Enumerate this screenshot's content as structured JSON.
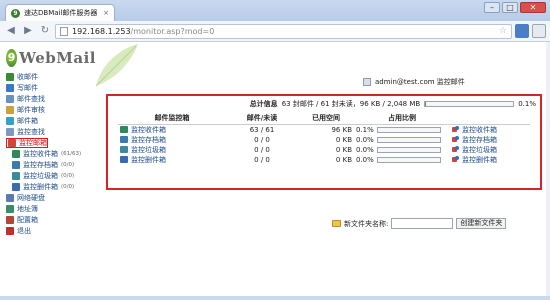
{
  "browser": {
    "tab_title": "速达DBMail邮件服务器 - V",
    "tab_close": "×",
    "url_host": "192.168.1.253",
    "url_path": "/monitor.asp?mod=0",
    "back": "◀",
    "forward": "▶",
    "reload": "↻",
    "star": "☆",
    "minimize": "–",
    "maximize": "□",
    "close": "✕"
  },
  "app": {
    "logo_letter": "9",
    "logo_text": "WebMail",
    "user_line": "admin@test.com 监控邮件"
  },
  "sidebar": {
    "items": [
      {
        "label": "收邮件",
        "icon": "inbox-icon",
        "color": "#3a8c3a"
      },
      {
        "label": "写邮件",
        "icon": "compose-icon",
        "color": "#3a78c9"
      },
      {
        "label": "邮件查找",
        "icon": "search-icon",
        "color": "#6b8fbf"
      },
      {
        "label": "邮件审核",
        "icon": "audit-icon",
        "color": "#c9a33a"
      },
      {
        "label": "邮件箱",
        "icon": "mailbox-icon",
        "color": "#3aa0c9"
      },
      {
        "label": "监控查找",
        "icon": "monitor-search-icon",
        "color": "#7a9ac0"
      },
      {
        "label": "监控邮箱",
        "icon": "monitor-icon",
        "color": "#c94a3a"
      },
      {
        "label": "网络硬盘",
        "icon": "disk-icon",
        "color": "#5a7ab0"
      },
      {
        "label": "地址簿",
        "icon": "addressbook-icon",
        "color": "#3a8c6a"
      },
      {
        "label": "配置箱",
        "icon": "config-icon",
        "color": "#b0473a"
      },
      {
        "label": "退出",
        "icon": "exit-icon",
        "color": "#c92a2a"
      }
    ],
    "sub_items": [
      {
        "label": "监控收件箱",
        "count": "(61/63)",
        "color": "#2f8a5a"
      },
      {
        "label": "监控存档箱",
        "count": "(0/0)",
        "color": "#3a7ab0"
      },
      {
        "label": "监控垃圾箱",
        "count": "(0/0)",
        "color": "#3a8c9a"
      },
      {
        "label": "监控删件箱",
        "count": "(0/0)",
        "color": "#3a6ab0"
      }
    ]
  },
  "summary": {
    "label": "总计信息",
    "text": "63 封邮件 / 61 封未读，96 KB / 2,048 MB",
    "percent_text": "0.1%",
    "percent_value": 0.001
  },
  "table": {
    "headers": [
      "邮件监控箱",
      "邮件/未读",
      "已用空间",
      "占用比例",
      ""
    ],
    "rows": [
      {
        "name": "监控收件箱",
        "counts": "63 / 61",
        "space": "96 KB",
        "pct": "0.1%",
        "pct_value": 0.001,
        "action": "监控收件箱",
        "color": "#2f8a5a"
      },
      {
        "name": "监控存档箱",
        "counts": "0 / 0",
        "space": "0 KB",
        "pct": "0.0%",
        "pct_value": 0.0,
        "action": "监控存档箱",
        "color": "#3a7ab0"
      },
      {
        "name": "监控垃圾箱",
        "counts": "0 / 0",
        "space": "0 KB",
        "pct": "0.0%",
        "pct_value": 0.0,
        "action": "监控垃圾箱",
        "color": "#3a8c9a"
      },
      {
        "name": "监控删件箱",
        "counts": "0 / 0",
        "space": "0 KB",
        "pct": "0.0%",
        "pct_value": 0.0,
        "action": "监控删件箱",
        "color": "#3a6ab0"
      }
    ]
  },
  "new_folder": {
    "label": "新文件夹名称:",
    "value": "",
    "button": "创建新文件夹"
  }
}
